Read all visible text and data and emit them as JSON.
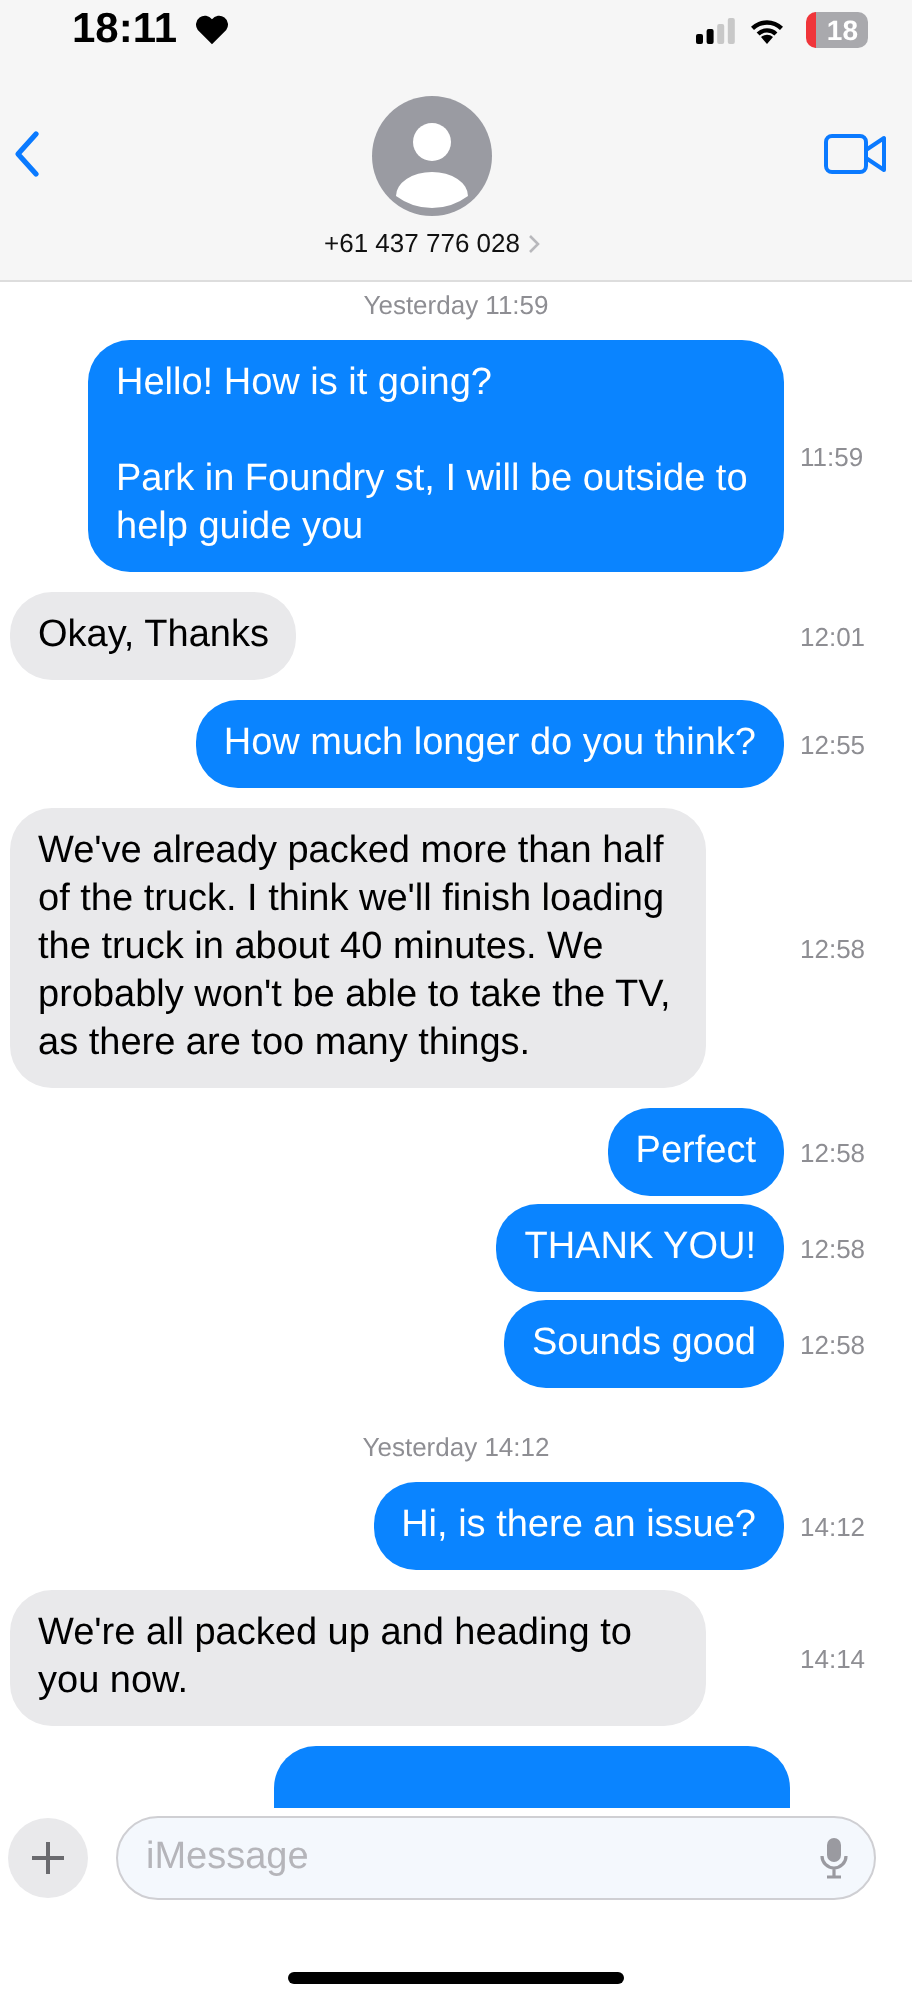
{
  "status_bar": {
    "time": "18:11",
    "battery": "18"
  },
  "header": {
    "contact": "+61 437 776 028"
  },
  "messages": [
    {
      "kind": "date",
      "text": "Yesterday 11:59"
    },
    {
      "kind": "sent",
      "text": "Hello! How is it going?\n\nPark in Foundry st, I will be outside to help guide you",
      "time": "11:59"
    },
    {
      "kind": "received",
      "text": "Okay, Thanks",
      "time": "12:01"
    },
    {
      "kind": "sent",
      "text": "How much longer do you think?",
      "time": "12:55"
    },
    {
      "kind": "received",
      "text": "We've already packed more than half of the truck. I think we'll finish loading the truck in about 40 minutes. We probably won't be able to take the TV, as there are too many things.",
      "time": "12:58"
    },
    {
      "kind": "sent",
      "text": "Perfect",
      "time": "12:58"
    },
    {
      "kind": "sent",
      "text": "THANK YOU!",
      "time": "12:58"
    },
    {
      "kind": "sent",
      "text": "Sounds good",
      "time": "12:58"
    },
    {
      "kind": "date",
      "text": "Yesterday 14:12"
    },
    {
      "kind": "sent",
      "text": "Hi, is there an issue?",
      "time": "14:12"
    },
    {
      "kind": "received",
      "text": "We're all packed up and heading to you now.",
      "time": "14:14"
    },
    {
      "kind": "sent-cut"
    }
  ],
  "composer": {
    "placeholder": "iMessage"
  }
}
